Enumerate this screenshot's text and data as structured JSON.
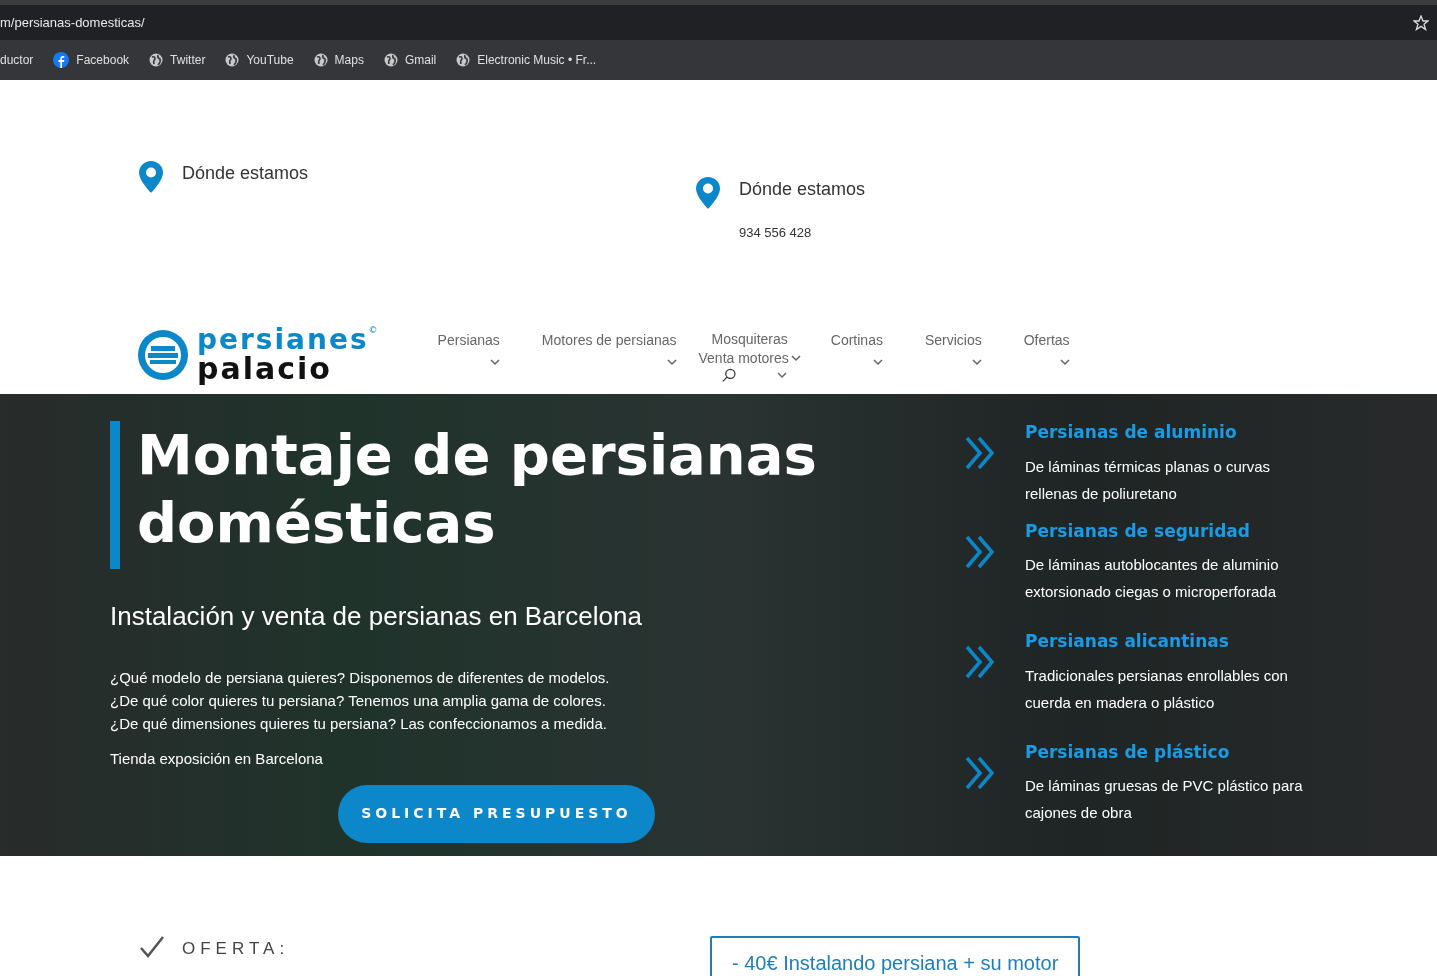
{
  "browser": {
    "url": "m/persianas-domesticas/",
    "bookmarks": [
      {
        "label": "ductor",
        "kind": "none"
      },
      {
        "label": "Facebook",
        "kind": "facebook"
      },
      {
        "label": "Twitter",
        "kind": "globe"
      },
      {
        "label": "YouTube",
        "kind": "globe"
      },
      {
        "label": "Maps",
        "kind": "globe"
      },
      {
        "label": "Gmail",
        "kind": "globe"
      },
      {
        "label": "Electronic Music • Fr...",
        "kind": "globe"
      }
    ]
  },
  "contact": [
    {
      "title": "Dónde estamos"
    },
    {
      "title": "Dónde estamos",
      "phone": "934 556 428"
    }
  ],
  "logo": {
    "top": "persianes",
    "bottom": "palacio",
    "mark": "©"
  },
  "nav": {
    "items": [
      {
        "label": "Persianas"
      },
      {
        "label": "Motores de persianas"
      },
      {
        "label": "Mosquiteras"
      },
      {
        "label": "Venta motores"
      },
      {
        "label": "Cortinas"
      },
      {
        "label": "Servicios"
      },
      {
        "label": "Ofertas"
      }
    ]
  },
  "hero": {
    "title": "Montaje de persianas domésticas",
    "subtitle": "Instalación y venta de persianas en Barcelona",
    "lines": [
      "¿Qué modelo de persiana quieres? Disponemos de diferentes de modelos.",
      "¿De qué color quieres tu persiana? Tenemos una amplia gama de colores.",
      "¿De qué dimensiones quieres tu persiana? Las confeccionamos a medida."
    ],
    "store": "Tienda exposición en Barcelona",
    "button": "SOLICITA PRESUPUESTO",
    "features": [
      {
        "title": "Persianas de aluminio",
        "text": "De láminas térmicas planas o curvas rellenas de poliuretano"
      },
      {
        "title": "Persianas de seguridad",
        "text": "De láminas autoblocantes de aluminio extorsionado ciegas o microperforada"
      },
      {
        "title": "Persianas alicantinas",
        "text": "Tradicionales persianas enrollables con cuerda en madera o plástico"
      },
      {
        "title": "Persianas de plástico",
        "text": "De láminas gruesas de PVC plástico para cajones de obra"
      }
    ]
  },
  "offer": {
    "label": "OFERTA:",
    "promo": "- 40€ Instalando persiana + su motor"
  }
}
